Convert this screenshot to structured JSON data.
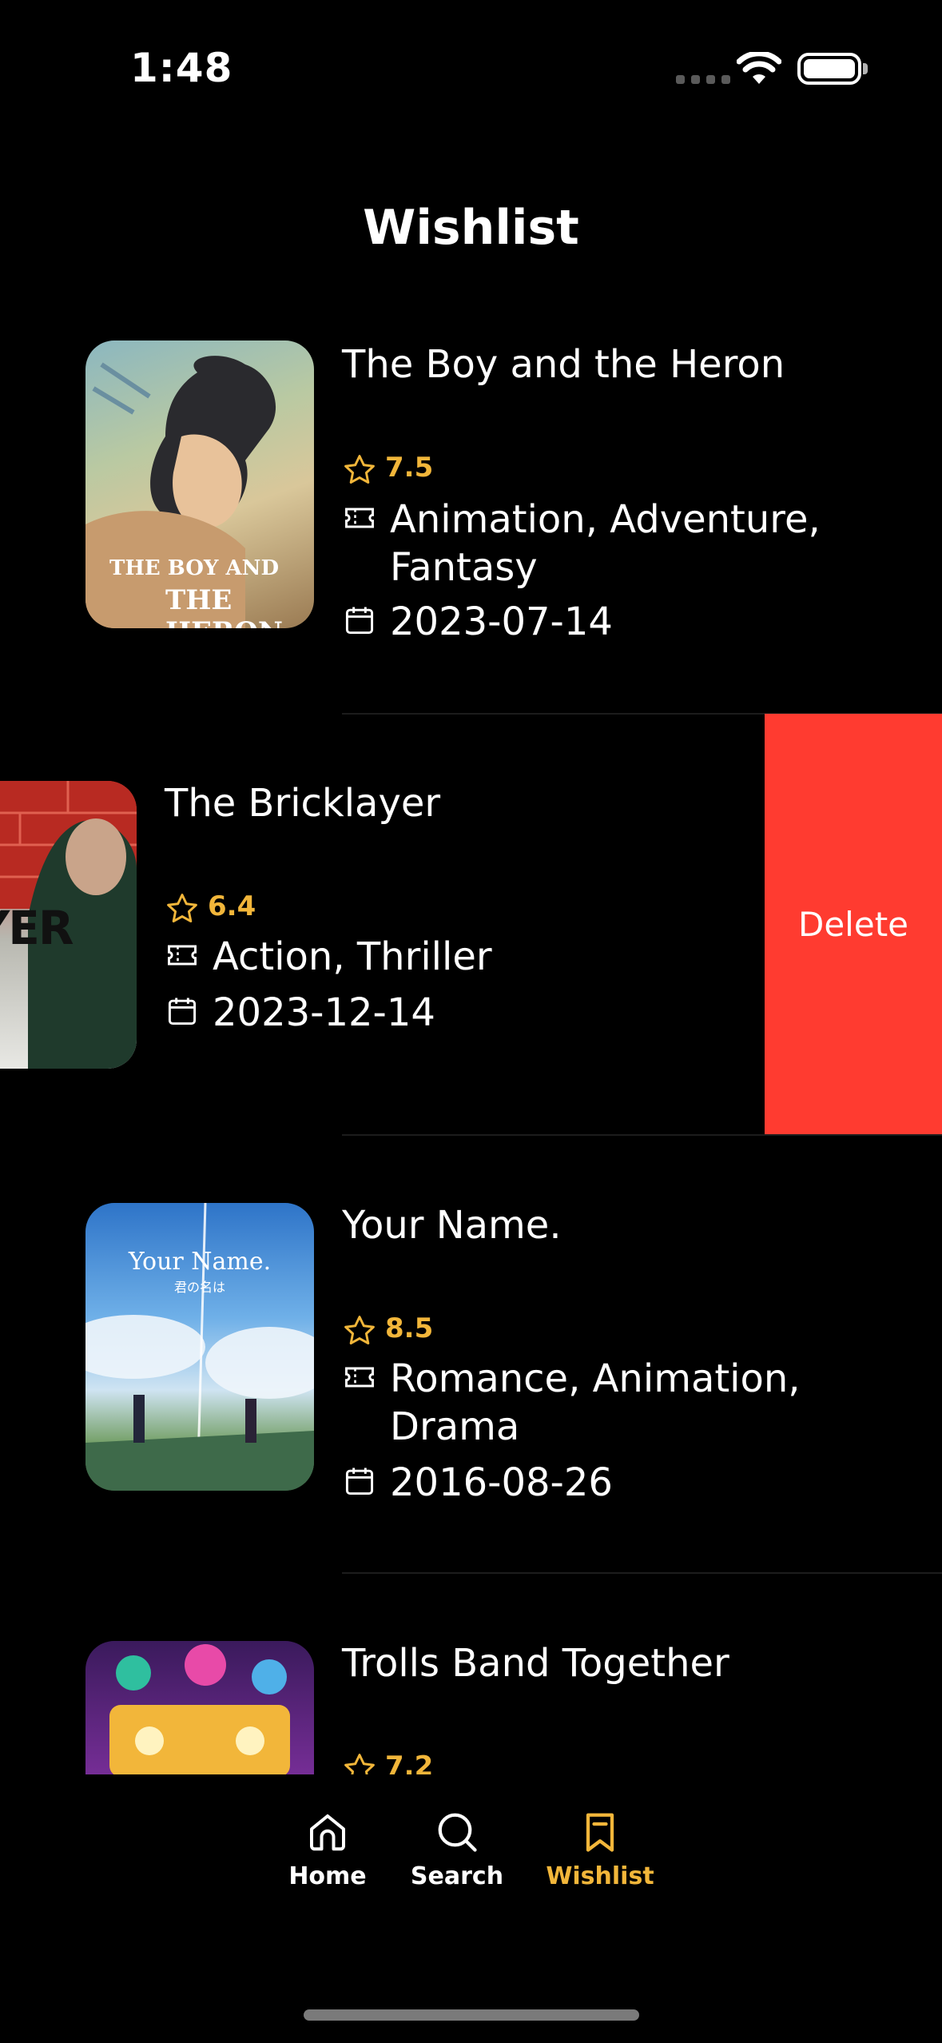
{
  "status_bar": {
    "time": "1:48"
  },
  "page": {
    "title": "Wishlist"
  },
  "movies": [
    {
      "title": "The Boy and the Heron",
      "rating": "7.5",
      "genres": "Animation, Adventure, Fantasy",
      "release_date": "2023-07-14",
      "poster_text_1": "THE BOY AND",
      "poster_text_2": "THE HERON"
    },
    {
      "title": "The Bricklayer",
      "rating": "6.4",
      "genres": "Action, Thriller",
      "release_date": "2023-12-14",
      "poster_text_1": "KLAYER"
    },
    {
      "title": "Your Name.",
      "rating": "8.5",
      "genres": "Romance, Animation, Drama",
      "release_date": "2016-08-26",
      "poster_text_1": "Your Name.",
      "poster_text_2": "君の名は"
    },
    {
      "title": "Trolls Band Together",
      "rating": "7.2"
    }
  ],
  "swipe_action": {
    "label": "Delete",
    "color": "#ff3b30"
  },
  "tab_bar": {
    "items": [
      {
        "label": "Home",
        "icon": "house-icon"
      },
      {
        "label": "Search",
        "icon": "search-icon"
      },
      {
        "label": "Wishlist",
        "icon": "bookmark-icon"
      }
    ],
    "active": "Wishlist",
    "accent_color": "#f2b63a"
  }
}
